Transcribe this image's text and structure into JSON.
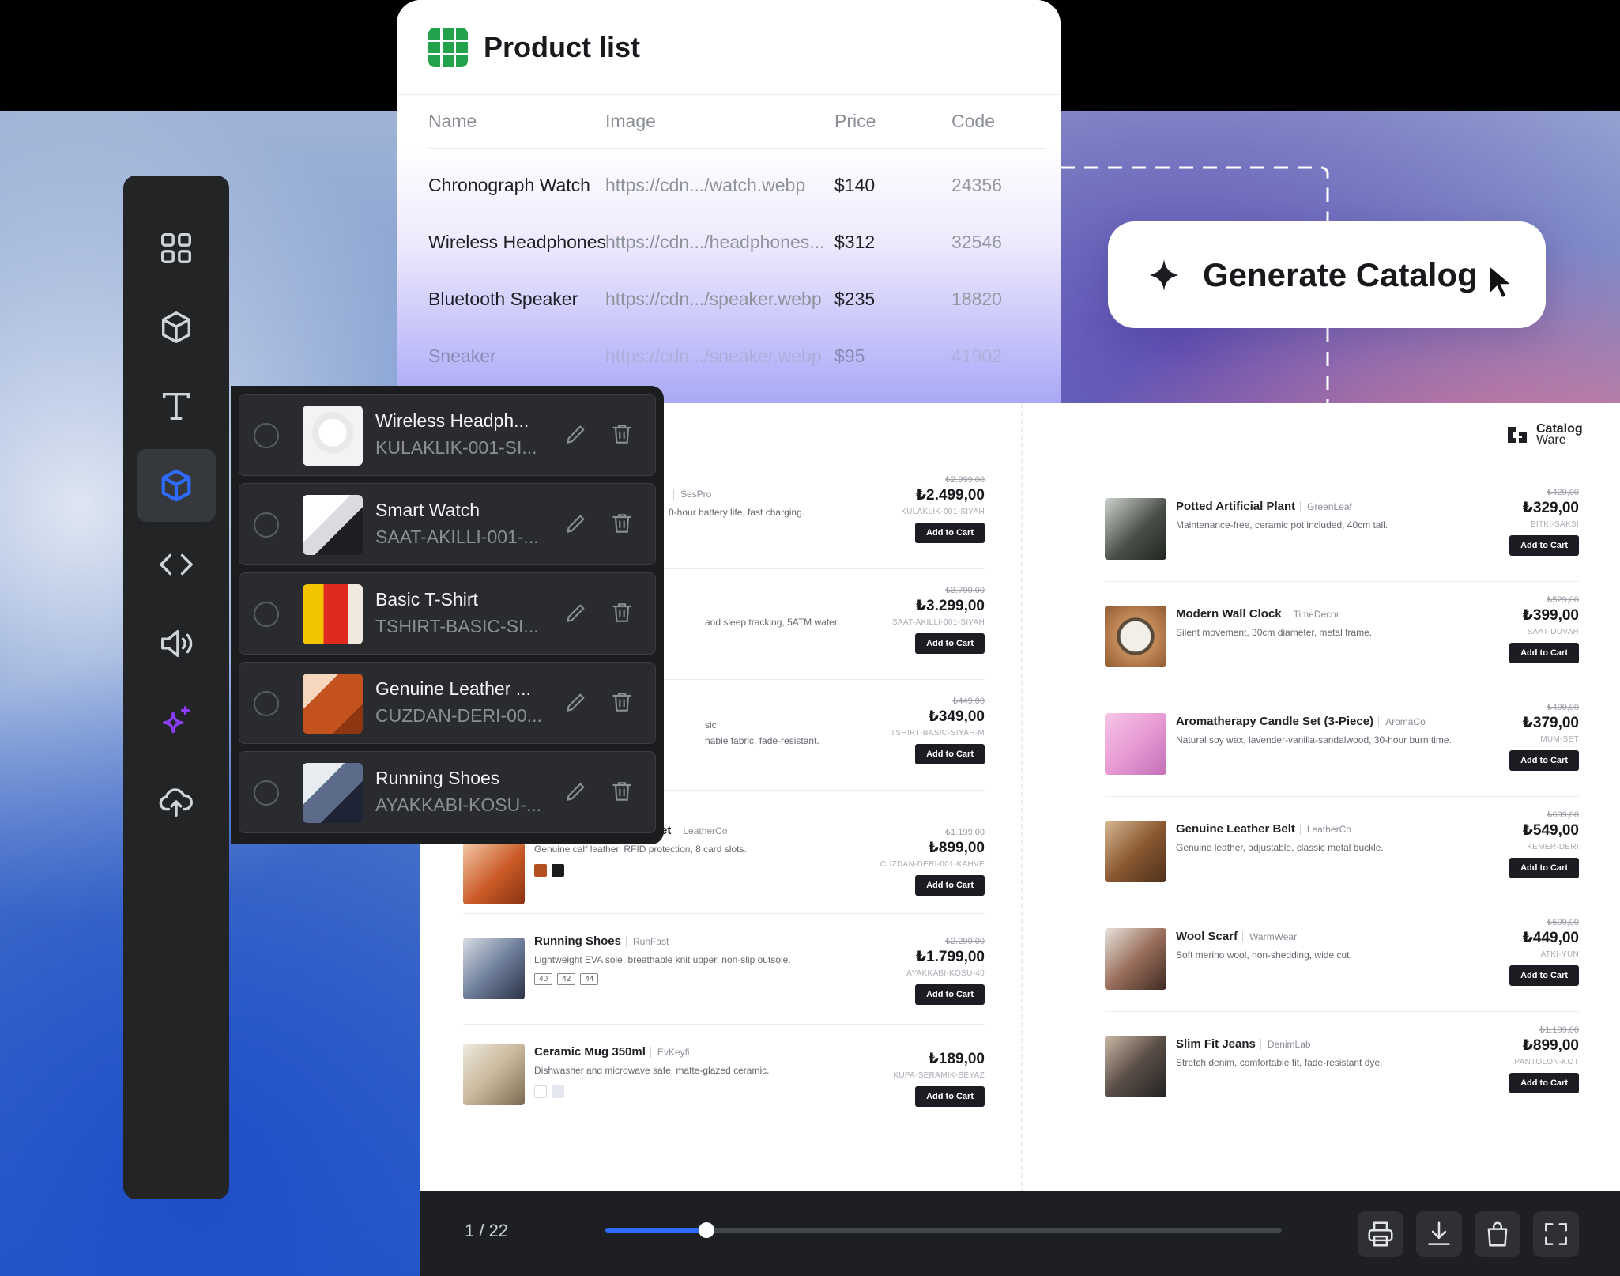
{
  "sidebar": {
    "items": [
      {
        "icon": "grid-icon"
      },
      {
        "icon": "cube-icon"
      },
      {
        "icon": "text-icon"
      },
      {
        "icon": "cube-icon",
        "active": true
      },
      {
        "icon": "code-icon"
      },
      {
        "icon": "speaker-icon"
      },
      {
        "icon": "sparkle-icon"
      },
      {
        "icon": "upload-cloud-icon"
      }
    ],
    "active_color": "#2f6bff",
    "sparkle_color": "#8b3dff"
  },
  "product_list": {
    "title": "Product list",
    "columns": [
      "Name",
      "Image",
      "Price",
      "Code"
    ],
    "rows": [
      {
        "name": "Chronograph Watch",
        "image": "https://cdn.../watch.webp",
        "price": "$140",
        "code": "24356"
      },
      {
        "name": "Wireless Headphones",
        "image": "https://cdn.../headphones...",
        "price": "$312",
        "code": "32546"
      },
      {
        "name": "Bluetooth Speaker",
        "image": "https://cdn.../speaker.webp",
        "price": "$235",
        "code": "18820"
      },
      {
        "name": "Sneaker",
        "image": "https://cdn.../sneaker.webp",
        "price": "$95",
        "code": "41902"
      }
    ],
    "icon_color": "#22a24a"
  },
  "generate": {
    "label": "Generate Catalog"
  },
  "overlay_items": [
    {
      "title": "Wireless Headph...",
      "sku": "KULAKLIK-001-SI..."
    },
    {
      "title": "Smart Watch",
      "sku": "SAAT-AKILLI-001-..."
    },
    {
      "title": "Basic T-Shirt",
      "sku": "TSHIRT-BASIC-SI..."
    },
    {
      "title": "Genuine Leather ...",
      "sku": "CUZDAN-DERI-00..."
    },
    {
      "title": "Running Shoes",
      "sku": "AYAKKABI-KOSU-..."
    }
  ],
  "catalog": {
    "logo": {
      "line1": "Catalog",
      "line2": "Ware"
    },
    "add_to_cart": "Add to Cart",
    "left": [
      {
        "name": "",
        "brand": "SesPro",
        "desc": "0-hour battery life, fast charging.",
        "old": "₺2.999,00",
        "price": "₺2.499,00",
        "sku": "KULAKLIK-001-SIYAH"
      },
      {
        "name": "",
        "brand": "",
        "desc": "and sleep tracking, 5ATM water",
        "old": "₺3.799,00",
        "price": "₺3.299,00",
        "sku": "SAAT-AKILLI-001-SIYAH"
      },
      {
        "name": "sic",
        "brand": "",
        "desc": "hable fabric, fade-resistant.",
        "old": "₺449,00",
        "price": "₺349,00",
        "sku": "TSHIRT-BASIC-SIYAH-M"
      },
      {
        "name": "et",
        "brand": "LeatherCo",
        "desc": "Genuine calf leather, RFID protection, 8 card slots.",
        "old": "₺1.199,00",
        "price": "₺899,00",
        "sku": "CUZDAN-DERI-001-KAHVE",
        "swatches": [
          "#b4501f",
          "#1b1b1b"
        ]
      },
      {
        "name": "Running Shoes",
        "brand": "RunFast",
        "desc": "Lightweight EVA sole, breathable knit upper, non-slip outsole.",
        "old": "₺2.299,00",
        "price": "₺1.799,00",
        "sku": "AYAKKABI-KOSU-40",
        "sizes": [
          "40",
          "42",
          "44"
        ]
      },
      {
        "name": "Ceramic Mug 350ml",
        "brand": "EvKeyfi",
        "desc": "Dishwasher and microwave safe, matte-glazed ceramic.",
        "old": "",
        "price": "₺189,00",
        "sku": "KUPA-SERAMIK-BEYAZ",
        "swatches": [
          "#ffffff",
          "#e4e8ee"
        ]
      }
    ],
    "right": [
      {
        "name": "Potted Artificial Plant",
        "brand": "GreenLeaf",
        "desc": "Maintenance-free, ceramic pot included, 40cm tall.",
        "old": "₺429,00",
        "price": "₺329,00",
        "sku": "BITKI-SAKSI"
      },
      {
        "name": "Modern Wall Clock",
        "brand": "TimeDecor",
        "desc": "Silent movement, 30cm diameter, metal frame.",
        "old": "₺529,00",
        "price": "₺399,00",
        "sku": "SAAT-DUVAR"
      },
      {
        "name": "Aromatherapy Candle Set (3-Piece)",
        "brand": "AromaCo",
        "desc": "Natural soy wax, lavender-vanilla-sandalwood, 30-hour burn time.",
        "old": "₺499,00",
        "price": "₺379,00",
        "sku": "MUM-SET"
      },
      {
        "name": "Genuine Leather Belt",
        "brand": "LeatherCo",
        "desc": "Genuine leather, adjustable, classic metal buckle.",
        "old": "₺699,00",
        "price": "₺549,00",
        "sku": "KEMER-DERI"
      },
      {
        "name": "Wool Scarf",
        "brand": "WarmWear",
        "desc": "Soft merino wool, non-shedding, wide cut.",
        "old": "₺599,00",
        "price": "₺449,00",
        "sku": "ATKI-YUN"
      },
      {
        "name": "Slim Fit Jeans",
        "brand": "DenimLab",
        "desc": "Stretch denim, comfortable fit, fade-resistant dye.",
        "old": "₺1.199,00",
        "price": "₺899,00",
        "sku": "PANTOLON-KOT"
      }
    ]
  },
  "viewer": {
    "pager": "1 / 22",
    "progress": 0.15,
    "tools": [
      "printer-icon",
      "download-icon",
      "shopping-bag-icon",
      "fullscreen-icon"
    ]
  }
}
